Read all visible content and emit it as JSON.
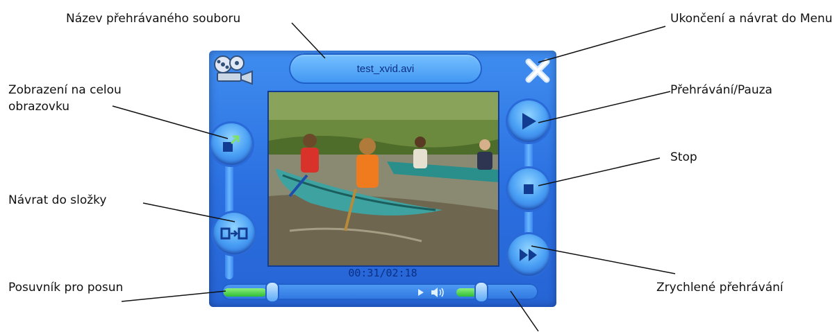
{
  "callouts": {
    "filename": "Název přehrávaného souboru",
    "exit": "Ukončení a návrat do Menu",
    "fullscreen": "Zobrazení na celou obrazovku",
    "play": "Přehrávání/Pauza",
    "stop": "Stop",
    "folder": "Návrat do složky",
    "seek": "Posuvník pro posun",
    "ff": "Zrychlené přehrávání"
  },
  "player": {
    "file_name": "test_xvid.avi",
    "time": "00:31/02:18",
    "seek_progress": 0.18,
    "volume_level": 0.35
  },
  "icons": [
    "film-reel-icon",
    "close-x-icon",
    "fullscreen-icon",
    "folder-return-icon",
    "play-icon",
    "stop-icon",
    "fast-forward-icon",
    "speaker-icon"
  ]
}
